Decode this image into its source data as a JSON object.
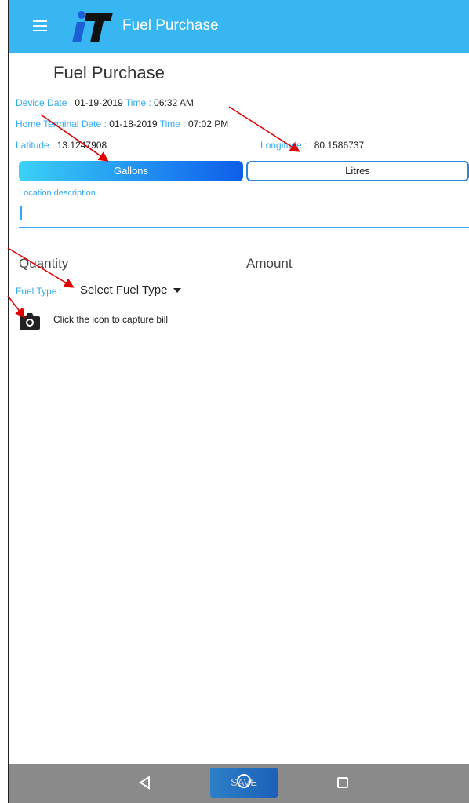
{
  "appbar": {
    "title": "Fuel Purchase",
    "logo_text": "iT"
  },
  "page": {
    "title": "Fuel Purchase"
  },
  "device": {
    "label": "Device",
    "date_label": "Date :",
    "date": "01-19-2019",
    "time_label": "Time :",
    "time": "06:32 AM"
  },
  "home_terminal": {
    "label": "Home Terminal",
    "date_label": "Date :",
    "date": "01-18-2019",
    "time_label": "Time :",
    "time": "07:02 PM"
  },
  "location": {
    "lat_label": "Latitude :",
    "lat": "13.1247908",
    "lon_label": "Longitude :",
    "lon": "80.1586737"
  },
  "units": {
    "gallons": "Gallons",
    "litres": "Litres",
    "selected": "Gallons"
  },
  "location_desc": {
    "label": "Location description",
    "value": ""
  },
  "quantity": {
    "placeholder": "Quantity"
  },
  "amount": {
    "placeholder": "Amount"
  },
  "fuel_type": {
    "label": "Fuel Type :",
    "value": "Select Fuel Type"
  },
  "capture": {
    "text": "Click the icon to capture bill"
  },
  "footer": {
    "save": "SAVE"
  },
  "colors": {
    "accent": "#38b6f2",
    "label": "#33aaf0",
    "annotation": "#e00000"
  }
}
